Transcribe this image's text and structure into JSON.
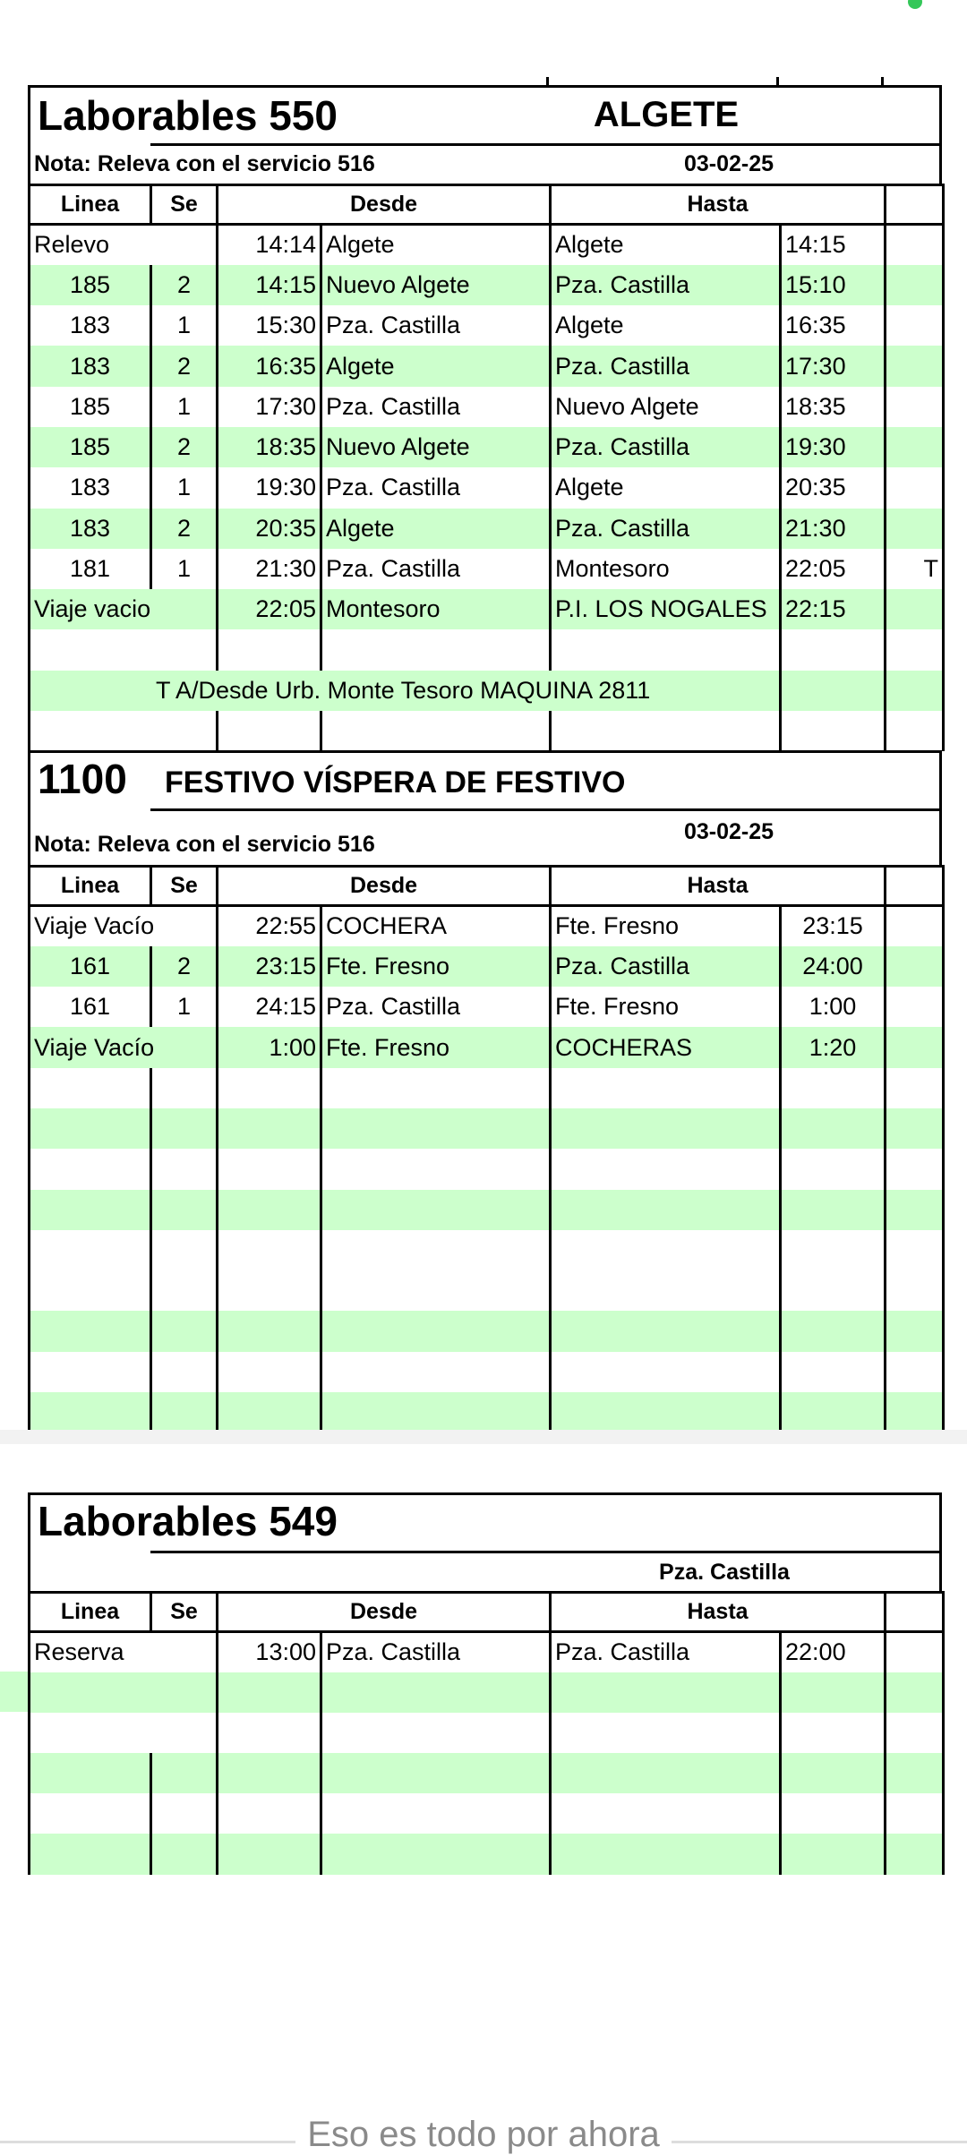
{
  "status_dot_color": "#34c759",
  "row_shade_color": "#ccffcc",
  "columns": {
    "linea": "Linea",
    "se": "Se",
    "desde": "Desde",
    "hasta": "Hasta"
  },
  "sections": [
    {
      "title": "Laborables 550",
      "place": "ALGETE",
      "note": "Nota: Releva con el servicio 516",
      "date": "03-02-25",
      "rows": [
        {
          "cells": [
            "Relevo",
            "",
            "14:14",
            "Algete",
            "Algete",
            "14:15",
            ""
          ],
          "shaded": false
        },
        {
          "cells": [
            "185",
            "2",
            "14:15",
            "Nuevo Algete",
            "Pza. Castilla",
            "15:10",
            ""
          ],
          "shaded": true
        },
        {
          "cells": [
            "183",
            "1",
            "15:30",
            "Pza. Castilla",
            "Algete",
            "16:35",
            ""
          ],
          "shaded": false
        },
        {
          "cells": [
            "183",
            "2",
            "16:35",
            "Algete",
            "Pza. Castilla",
            "17:30",
            ""
          ],
          "shaded": true
        },
        {
          "cells": [
            "185",
            "1",
            "17:30",
            "Pza. Castilla",
            "Nuevo Algete",
            "18:35",
            ""
          ],
          "shaded": false
        },
        {
          "cells": [
            "185",
            "2",
            "18:35",
            "Nuevo Algete",
            "Pza. Castilla",
            "19:30",
            ""
          ],
          "shaded": true
        },
        {
          "cells": [
            "183",
            "1",
            "19:30",
            "Pza. Castilla",
            "Algete",
            "20:35",
            ""
          ],
          "shaded": false
        },
        {
          "cells": [
            "183",
            "2",
            "20:35",
            "Algete",
            "Pza. Castilla",
            "21:30",
            ""
          ],
          "shaded": true
        },
        {
          "cells": [
            "181",
            "1",
            "21:30",
            "Pza. Castilla",
            "Montesoro",
            "22:05",
            "T"
          ],
          "shaded": false
        },
        {
          "cells": [
            "Viaje vacio",
            "",
            "22:05",
            "Montesoro",
            "P.I. LOS NOGALES",
            "22:15",
            ""
          ],
          "shaded": true
        },
        {
          "cells": [
            "",
            "",
            "",
            "",
            "",
            "",
            ""
          ],
          "shaded": false
        },
        {
          "cells": [
            "T A/Desde Urb. Monte Tesoro  MAQUINA 2811",
            "",
            "",
            "",
            "",
            "",
            ""
          ],
          "shaded": true
        },
        {
          "cells": [
            "",
            "",
            "",
            "",
            "",
            "",
            ""
          ],
          "shaded": false
        }
      ]
    },
    {
      "title": "1100",
      "place": "FESTIVO VÍSPERA DE FESTIVO",
      "note": "Nota: Releva con el servicio 516",
      "date": "03-02-25",
      "rows": [
        {
          "cells": [
            "Viaje Vacío",
            "",
            "22:55",
            "COCHERA",
            "Fte. Fresno",
            "23:15",
            ""
          ],
          "shaded": false
        },
        {
          "cells": [
            "161",
            "2",
            "23:15",
            "Fte. Fresno",
            "Pza. Castilla",
            "24:00",
            ""
          ],
          "shaded": true
        },
        {
          "cells": [
            "161",
            "1",
            "24:15",
            "Pza. Castilla",
            "Fte. Fresno",
            "1:00",
            ""
          ],
          "shaded": false
        },
        {
          "cells": [
            "Viaje Vacío",
            "",
            "1:00",
            "Fte. Fresno",
            "COCHERAS",
            "1:20",
            ""
          ],
          "shaded": true
        },
        {
          "cells": [
            "",
            "",
            "",
            "",
            "",
            "",
            ""
          ],
          "shaded": false
        },
        {
          "cells": [
            "",
            "",
            "",
            "",
            "",
            "",
            ""
          ],
          "shaded": true
        },
        {
          "cells": [
            "",
            "",
            "",
            "",
            "",
            "",
            ""
          ],
          "shaded": false
        },
        {
          "cells": [
            "",
            "",
            "",
            "",
            "",
            "",
            ""
          ],
          "shaded": true
        },
        {
          "cells": [
            "",
            "",
            "",
            "",
            "",
            "",
            ""
          ],
          "shaded": false
        },
        {
          "cells": [
            "",
            "",
            "",
            "",
            "",
            "",
            ""
          ],
          "shaded": true
        },
        {
          "cells": [
            "",
            "",
            "",
            "",
            "",
            "",
            ""
          ],
          "shaded": false
        },
        {
          "cells": [
            "",
            "",
            "",
            "",
            "",
            "",
            ""
          ],
          "shaded": true
        }
      ]
    },
    {
      "title": "Laborables 549",
      "place": "Pza. Castilla",
      "rows": [
        {
          "cells": [
            "Reserva",
            "",
            "13:00",
            "Pza. Castilla",
            "Pza. Castilla",
            "22:00",
            ""
          ],
          "shaded": false
        },
        {
          "cells": [
            "",
            "",
            "",
            "",
            "",
            "",
            ""
          ],
          "shaded": true
        },
        {
          "cells": [
            "",
            "",
            "",
            "",
            "",
            "",
            ""
          ],
          "shaded": false
        },
        {
          "cells": [
            "",
            "",
            "",
            "",
            "",
            "",
            ""
          ],
          "shaded": true
        },
        {
          "cells": [
            "",
            "",
            "",
            "",
            "",
            "",
            ""
          ],
          "shaded": false
        },
        {
          "cells": [
            "",
            "",
            "",
            "",
            "",
            "",
            ""
          ],
          "shaded": true
        }
      ]
    }
  ],
  "footer": "Eso es todo por ahora"
}
